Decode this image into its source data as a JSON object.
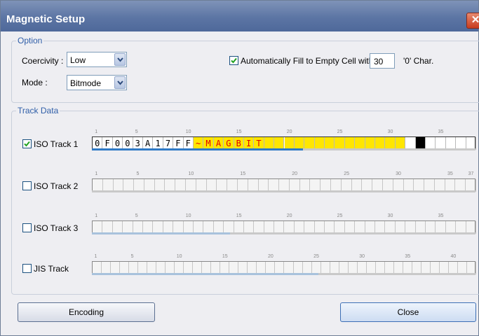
{
  "window": {
    "title": "Magnetic Setup",
    "close_glyph": "✕"
  },
  "option": {
    "legend": "Option",
    "coercivity_label": "Coercivity :",
    "coercivity_value": "Low",
    "mode_label": "Mode :",
    "mode_value": "Bitmode",
    "autofill_checked": true,
    "autofill_label": "Automatically Fill to Empty Cell with",
    "autofill_value": "30",
    "autofill_suffix": "'0'  Char."
  },
  "track_data": {
    "legend": "Track Data",
    "tracks": [
      {
        "label": "ISO Track 1",
        "checked": true,
        "cells": 38,
        "ticks": [
          "1",
          "5",
          "10",
          "15",
          "20",
          "25",
          "30",
          "35"
        ],
        "progress": 0.55,
        "chars": [
          "0",
          "F",
          "0",
          "0",
          "3",
          "A",
          "1",
          "7",
          "F",
          "F",
          "~",
          "M",
          "A",
          "G",
          "B",
          "I",
          "T"
        ]
      },
      {
        "label": "ISO Track 2",
        "checked": false,
        "cells": 37,
        "ticks": [
          "1",
          "5",
          "10",
          "15",
          "20",
          "25",
          "30",
          "35",
          "37"
        ],
        "progress": 0.0,
        "chars": []
      },
      {
        "label": "ISO Track 3",
        "checked": false,
        "cells": 38,
        "ticks": [
          "1",
          "5",
          "10",
          "15",
          "20",
          "25",
          "30",
          "35"
        ],
        "progress": 0.36,
        "chars": []
      },
      {
        "label": "JIS Track",
        "checked": false,
        "cells": 42,
        "ticks": [
          "1",
          "5",
          "10",
          "15",
          "20",
          "25",
          "30",
          "35",
          "40"
        ],
        "progress": 0.59,
        "chars": []
      }
    ]
  },
  "buttons": {
    "encoding": "Encoding",
    "close": "Close"
  },
  "colors": {
    "highlight": "#ffe600",
    "char_normal": "#000000",
    "char_highlight": "#e00000",
    "cursor": "#000000",
    "progress": "#2f7ac6"
  }
}
